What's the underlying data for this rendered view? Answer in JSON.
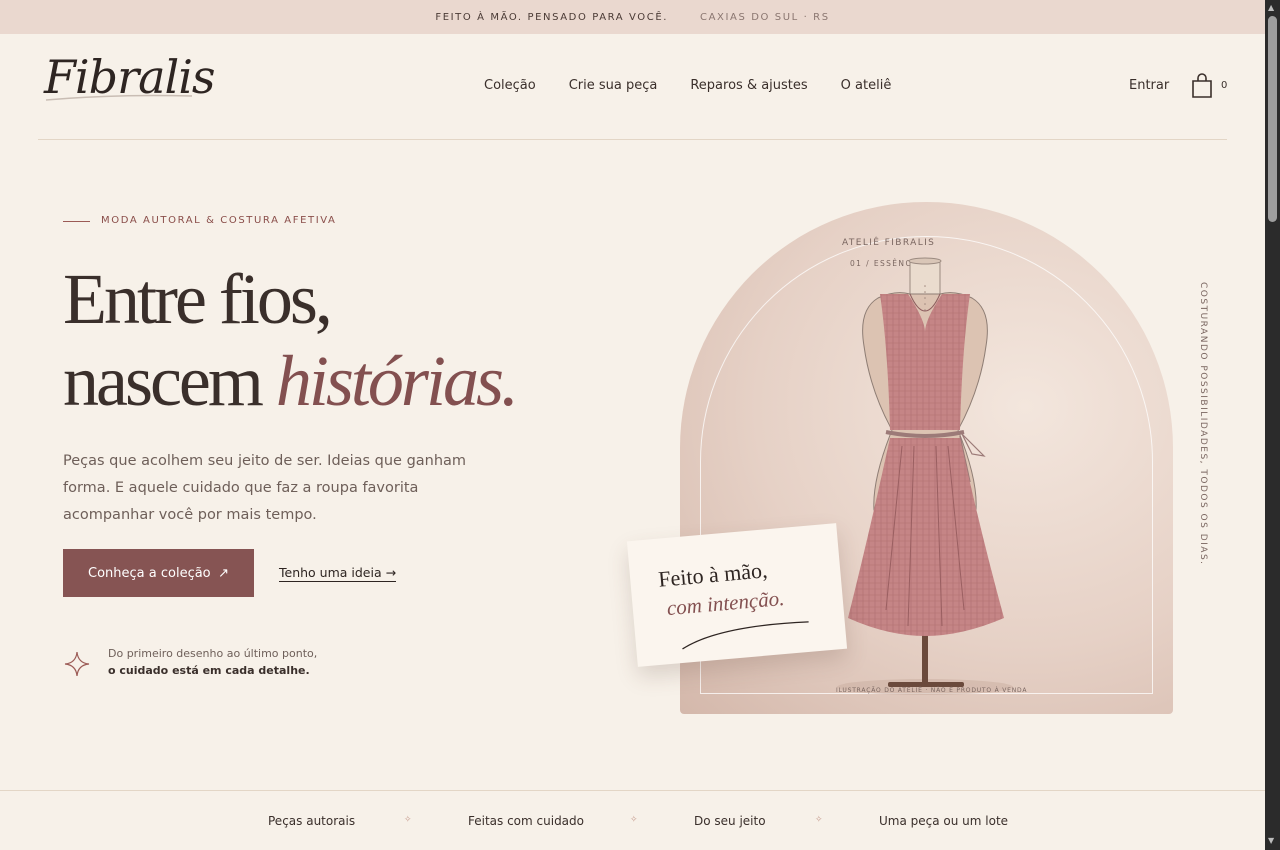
{
  "topbar": {
    "tagline": "FEITO À MÃO. PENSADO PARA VOCÊ.",
    "location": "CAXIAS DO SUL · RS"
  },
  "header": {
    "logo": "Fibralis",
    "nav": [
      "Coleção",
      "Crie sua peça",
      "Reparos & ajustes",
      "O ateliê"
    ],
    "login": "Entrar",
    "cart_count": "0",
    "icons": {
      "cart": "shopping-bag-icon"
    }
  },
  "hero": {
    "eyebrow": "MODA AUTORAL & COSTURA AFETIVA",
    "title_line1": "Entre fios,",
    "title_line2_plain": "nascem ",
    "title_line2_accent": "histórias.",
    "lead": "Peças que acolhem seu jeito de ser. Ideias que ganham forma. E aquele cuidado que faz a roupa favorita acompanhar você por mais tempo.",
    "primary_cta": "Conheça a coleção",
    "primary_cta_arrow": "↗",
    "secondary_cta": "Tenho uma ideia →",
    "note_line1": "Do primeiro desenho ao último ponto,",
    "note_line2": "o cuidado está em cada detalhe."
  },
  "visual": {
    "label": "ATELIÊ FIBRALIS",
    "sublabel": "01 / ESSÊNCIA",
    "card_line1": "Feito à mão,",
    "card_line2": "com intenção.",
    "illustration_note": "ILUSTRAÇÃO DO ATELIÊ · NÃO É PRODUTO À VENDA",
    "vertical_text": "COSTURANDO POSSIBILIDADES, TODOS OS DIAS."
  },
  "strip": {
    "items": [
      "Peças autorais",
      "Feitas com cuidado",
      "Do seu jeito",
      "Uma peça ou um lote"
    ]
  },
  "colors": {
    "accent": "#865453",
    "background": "#f7f1e9",
    "topbar": "#ead8cf"
  }
}
